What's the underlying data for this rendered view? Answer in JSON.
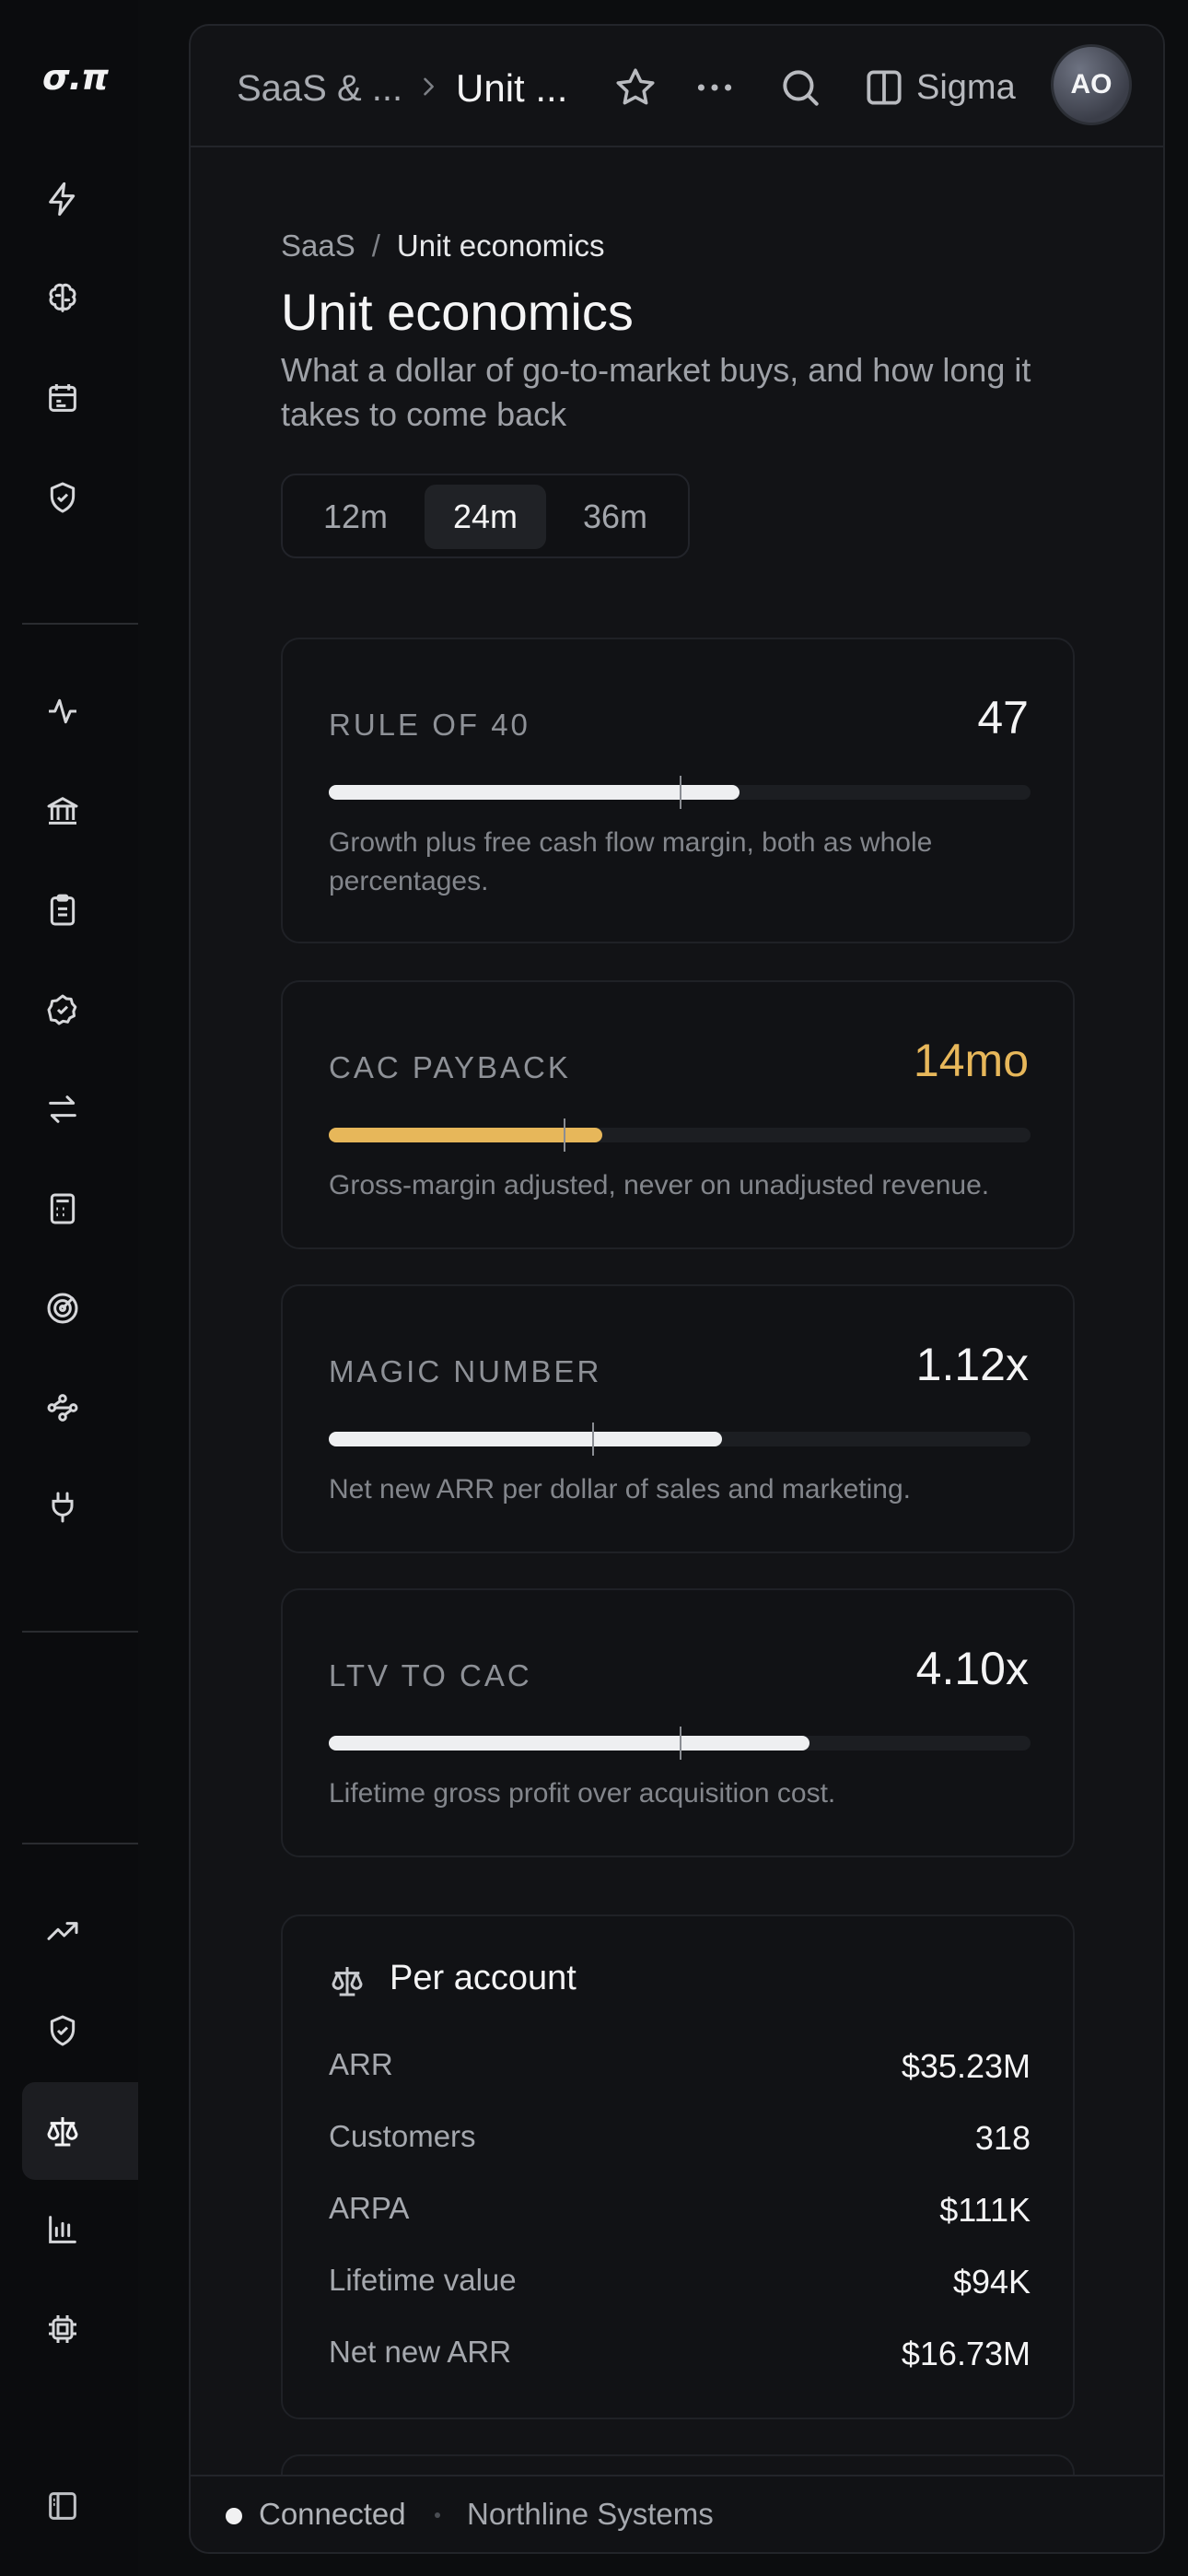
{
  "app": {
    "logo": "σ.π"
  },
  "topbar": {
    "crumb_parent": "SaaS & ...",
    "crumb_current": "Unit ...",
    "workspace": "Sigma",
    "avatar_initials": "AO"
  },
  "page": {
    "breadcrumb_root": "SaaS",
    "breadcrumb_separator": "/",
    "breadcrumb_current": "Unit economics",
    "title": "Unit economics",
    "subtitle": "What a dollar of go-to-market buys, and how long it takes to come back"
  },
  "range_selector": {
    "options": [
      "12m",
      "24m",
      "36m"
    ],
    "selected": "24m"
  },
  "metrics": [
    {
      "label": "RULE OF 40",
      "value": "47",
      "fill": 0.585,
      "marker": 0.5,
      "status": "normal",
      "description": "Growth plus free cash flow margin, both as whole percentages."
    },
    {
      "label": "CAC PAYBACK",
      "value": "14mo",
      "fill": 0.39,
      "marker": 0.335,
      "status": "warning",
      "description": "Gross-margin adjusted, never on unadjusted revenue."
    },
    {
      "label": "MAGIC NUMBER",
      "value": "1.12x",
      "fill": 0.56,
      "marker": 0.375,
      "status": "normal",
      "description": "Net new ARR per dollar of sales and marketing."
    },
    {
      "label": "LTV TO CAC",
      "value": "4.10x",
      "fill": 0.685,
      "marker": 0.5,
      "status": "normal",
      "description": "Lifetime gross profit over acquisition cost."
    }
  ],
  "per_account": {
    "title": "Per account",
    "rows": [
      {
        "label": "ARR",
        "value": "$35.23M"
      },
      {
        "label": "Customers",
        "value": "318"
      },
      {
        "label": "ARPA",
        "value": "$111K"
      },
      {
        "label": "Lifetime value",
        "value": "$94K"
      },
      {
        "label": "Net new ARR",
        "value": "$16.73M"
      }
    ]
  },
  "statusbar": {
    "connection": "Connected",
    "organization": "Northline Systems"
  },
  "colors": {
    "accent_warning": "#e7b75a",
    "bar_fill": "#eeeff1",
    "background": "#0c0d0f"
  },
  "icons": {
    "rail": [
      "bolt-icon",
      "brain-icon",
      "calendar-icon",
      "shield-check-icon",
      "pulse-icon",
      "bank-icon",
      "clipboard-icon",
      "badge-check-icon",
      "arrows-swap-icon",
      "calculator-icon",
      "target-icon",
      "nodes-icon",
      "plug-icon",
      "trending-up-icon",
      "shield-check-icon",
      "scale-icon",
      "bar-chart-icon",
      "chip-icon",
      "sidebar-toggle-icon"
    ],
    "topbar": [
      "chevron-right-icon",
      "star-icon",
      "more-icon",
      "search-icon",
      "panel-icon"
    ]
  }
}
